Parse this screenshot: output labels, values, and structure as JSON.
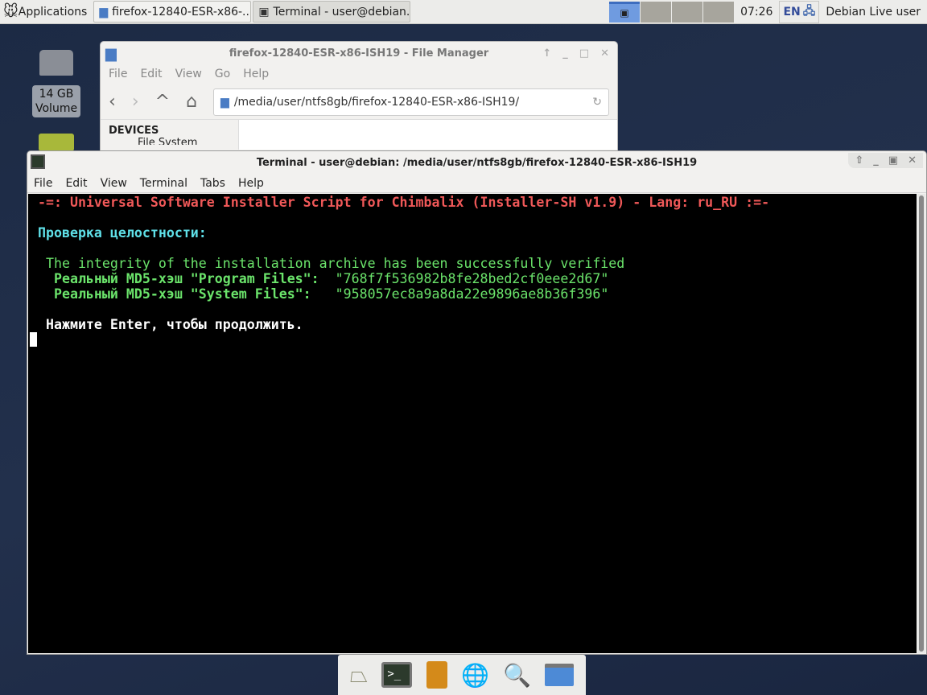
{
  "panel": {
    "applications_label": "Applications",
    "tasks": [
      {
        "label": "firefox-12840-ESR-x86-..."
      },
      {
        "label": "Terminal - user@debian..."
      }
    ],
    "clock": "07:26",
    "keyboard_layout": "EN",
    "user": "Debian Live user"
  },
  "desktop": {
    "volume_label_line1": "14 GB",
    "volume_label_line2": "Volume"
  },
  "file_manager": {
    "title": "firefox-12840-ESR-x86-ISH19 - File Manager",
    "menu": [
      "File",
      "Edit",
      "View",
      "Go",
      "Help"
    ],
    "path": "/media/user/ntfs8gb/firefox-12840-ESR-x86-ISH19/",
    "sidebar_heading": "DEVICES",
    "sidebar_item": "File System"
  },
  "terminal": {
    "title": "Terminal - user@debian: /media/user/ntfs8gb/firefox-12840-ESR-x86-ISH19",
    "menu": [
      "File",
      "Edit",
      "View",
      "Terminal",
      "Tabs",
      "Help"
    ],
    "lines": {
      "header": " -=: Universal Software Installer Script for Chimbalix (Installer-SH v1.9) - Lang: ru_RU :=-",
      "check": " Проверка целостности:",
      "verified": "  The integrity of the installation archive has been successfully verified",
      "md5_prog_label": "   Реальный MD5-хэш \"Program Files\":",
      "md5_prog_value": "  \"768f7f536982b8fe28bed2cf0eee2d67\"",
      "md5_sys_label": "   Реальный MD5-хэш \"System Files\":",
      "md5_sys_value": "   \"958057ec8a9a8da22e9896ae8b36f396\"",
      "prompt": "  Нажмите Enter, чтобы продолжить."
    }
  },
  "colors": {
    "header": "#ef5858",
    "heading": "#5fe0e8",
    "ok": "#6be46b"
  }
}
